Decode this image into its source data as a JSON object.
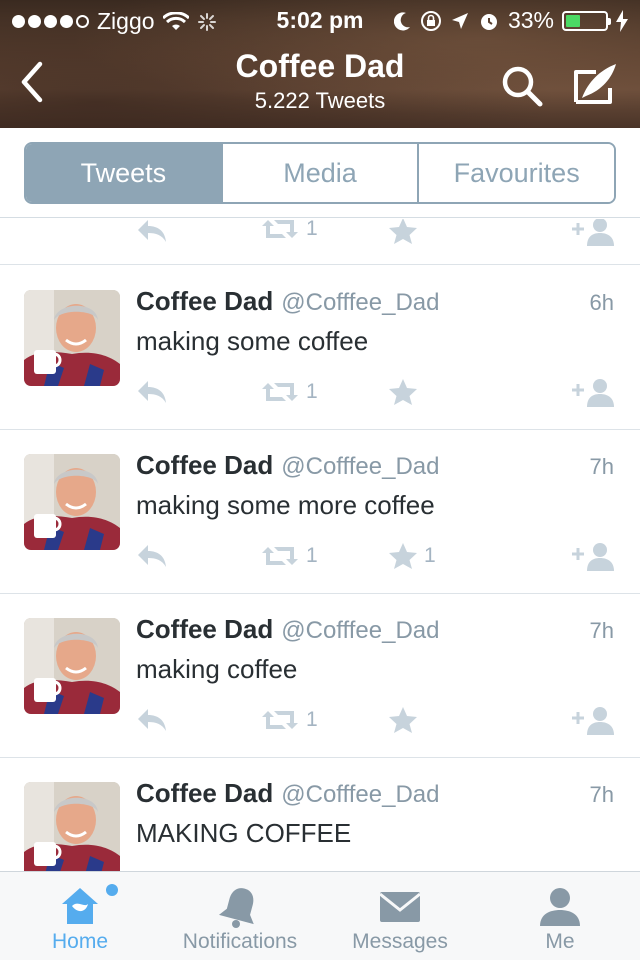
{
  "status_bar": {
    "carrier": "Ziggo",
    "time": "5:02 pm",
    "battery_percent": "33%",
    "battery_level": 0.33
  },
  "profile": {
    "title": "Coffee Dad",
    "tweet_count": "5.222 Tweets"
  },
  "tabs": [
    "Tweets",
    "Media",
    "Favourites"
  ],
  "partial_tweet": {
    "retweets": "1"
  },
  "tweets": [
    {
      "name": "Coffee Dad",
      "handle": "@Cofffee_Dad",
      "time": "6h",
      "text": "making some coffee",
      "retweets": "1",
      "favorites": ""
    },
    {
      "name": "Coffee Dad",
      "handle": "@Cofffee_Dad",
      "time": "7h",
      "text": "making some more coffee",
      "retweets": "1",
      "favorites": "1"
    },
    {
      "name": "Coffee Dad",
      "handle": "@Cofffee_Dad",
      "time": "7h",
      "text": "making coffee",
      "retweets": "1",
      "favorites": ""
    },
    {
      "name": "Coffee Dad",
      "handle": "@Cofffee_Dad",
      "time": "7h",
      "text": "MAKING COFFEE",
      "retweets": "",
      "favorites": ""
    }
  ],
  "tab_bar": {
    "home": "Home",
    "notifications": "Notifications",
    "messages": "Messages",
    "me": "Me"
  },
  "colors": {
    "accent": "#55acee",
    "segment": "#8ea5b5",
    "action_icon": "#a4b4c2",
    "battery": "#4cd964"
  }
}
